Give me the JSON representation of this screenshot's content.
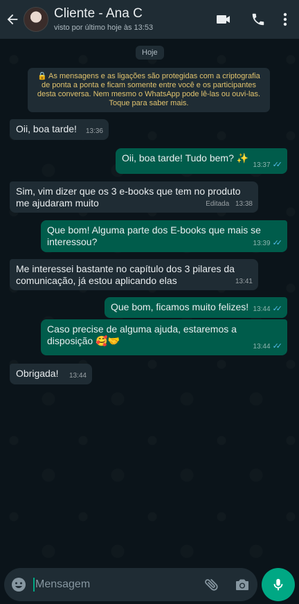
{
  "header": {
    "title": "Cliente - Ana C",
    "subtitle": "visto por último hoje às 13:53",
    "icons": [
      "back-arrow-icon",
      "video-call-icon",
      "voice-call-icon",
      "more-options-icon"
    ]
  },
  "chat": {
    "day_label": "Hoje",
    "encryption_notice": "As mensagens e as ligações são protegidas com a criptografia de ponta a ponta e ficam somente entre você e os participantes desta conversa. Nem mesmo o WhatsApp pode lê-las ou ouvi-las. Toque para saber mais.",
    "messages": [
      {
        "direction": "in",
        "text": "Oii, boa tarde!",
        "time": "13:36"
      },
      {
        "direction": "out",
        "text": "Oii, boa tarde! Tudo bem? ✨",
        "time": "13:37",
        "status": "read"
      },
      {
        "direction": "in",
        "text": "Sim, vim dizer que os 3 e-books que tem no produto me ajudaram muito",
        "edited": "Editada",
        "time": "13:38"
      },
      {
        "direction": "out",
        "text": "Que bom! Alguma parte dos E-books que mais se interessou?",
        "time": "13:39",
        "status": "read"
      },
      {
        "direction": "in",
        "text": "Me interessei bastante no capítulo dos 3 pilares da comunicação, já estou aplicando elas",
        "time": "13:41"
      },
      {
        "direction": "out",
        "text": "Que bom, ficamos muito felizes!",
        "time": "13:44",
        "status": "read"
      },
      {
        "direction": "out",
        "text": "Caso precise de alguma ajuda, estaremos a disposição 🥰🤝",
        "time": "13:44",
        "status": "read"
      },
      {
        "direction": "in",
        "text": "Obrigada!",
        "time": "13:44"
      }
    ]
  },
  "composer": {
    "placeholder": "Mensagem",
    "icons": [
      "emoji-icon",
      "attach-icon",
      "camera-icon",
      "mic-icon"
    ]
  },
  "colors": {
    "header_bg": "#1f2c34",
    "chat_bg": "#0b141a",
    "incoming_bubble": "#1f2c34",
    "outgoing_bubble": "#005c4b",
    "accent": "#00a884",
    "read_ticks": "#53bdeb",
    "notice_text": "#e2c46f"
  }
}
